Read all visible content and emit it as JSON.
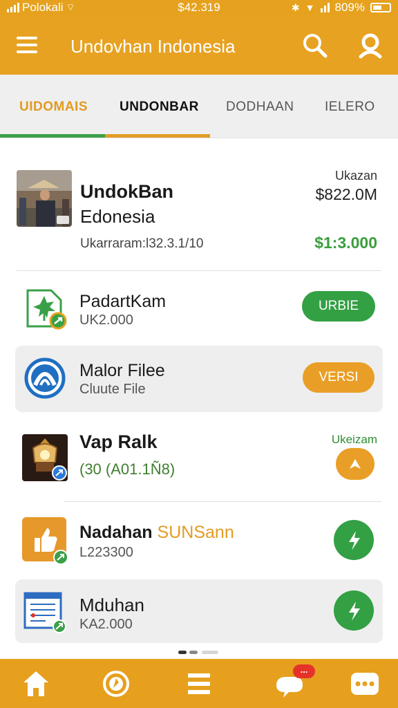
{
  "status_bar": {
    "carrier": "Polokali",
    "time": "$42.319",
    "battery": "809%"
  },
  "app_bar": {
    "title": "Undovhan Indonesia",
    "menu_icon": "hamburger-menu-icon",
    "search_icon": "search-icon",
    "profile_icon": "profile-icon"
  },
  "tabs": [
    {
      "label": "UIDOMAIS",
      "active": true
    },
    {
      "label": "UNDONBAR",
      "active": false
    },
    {
      "label": "DODHAAN",
      "active": false
    },
    {
      "label": "IELERO",
      "active": false
    }
  ],
  "hero": {
    "title": "UndokBan",
    "subtitle": "Edonesia",
    "meta": "Ukarraram:l32.3.1/10",
    "right_label": "Ukazan",
    "price": "$822.0M",
    "change": "$1:3.000"
  },
  "items": [
    {
      "title": "PadartKam",
      "subtitle": "UK2.000",
      "action": "URBIE",
      "icon": "leaf-document-icon"
    },
    {
      "title": "Malor Filee",
      "subtitle": "Cluute File",
      "action": "VERSI",
      "icon": "arch-logo-icon"
    },
    {
      "title": "Vap Ralk",
      "subtitle": "(30 (A01.1Ñ8)",
      "tag": "Ukeizam",
      "icon": "lantern-icon"
    },
    {
      "title": "Nadahan",
      "title_accent": "SUNSann",
      "subtitle": "L223300",
      "icon": "thumbs-up-icon"
    },
    {
      "title": "Mduhan",
      "subtitle": "KA2.000",
      "icon": "spreadsheet-icon"
    }
  ],
  "pager": {
    "pages": 3,
    "active": 0
  },
  "bottom_nav": [
    {
      "icon": "home-icon"
    },
    {
      "icon": "compass-icon"
    },
    {
      "icon": "list-icon"
    },
    {
      "icon": "chat-bubble-icon",
      "badge": "..."
    },
    {
      "icon": "more-icon"
    }
  ],
  "colors": {
    "primary": "#e6a21e",
    "green": "#3aa047",
    "orange_button": "#e99f27"
  }
}
